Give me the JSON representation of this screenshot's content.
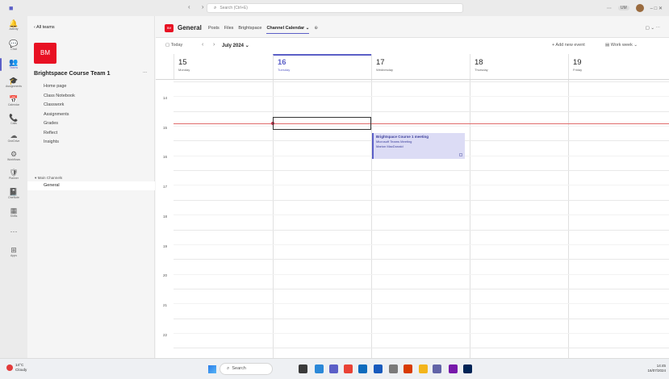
{
  "titlebar": {
    "search_placeholder": "Search (Ctrl+E)",
    "nav": "‹ ›",
    "controls": "⋯",
    "org_badge": "UM",
    "window_buttons": "– □ ✕"
  },
  "rail": [
    {
      "icon": "🔔",
      "label": "Activity"
    },
    {
      "icon": "💬",
      "label": "Chat"
    },
    {
      "icon": "👥",
      "label": "Teams"
    },
    {
      "icon": "🎓",
      "label": "Assignments"
    },
    {
      "icon": "📅",
      "label": "Calendar"
    },
    {
      "icon": "📞",
      "label": "Calls"
    },
    {
      "icon": "☁",
      "label": "OneDrive"
    },
    {
      "icon": "⚙",
      "label": "Workflows"
    },
    {
      "icon": "🛡",
      "label": "Planner"
    },
    {
      "icon": "📓",
      "label": "OneNote"
    },
    {
      "icon": "▦",
      "label": "Shifts"
    },
    {
      "icon": "⋯",
      "label": ""
    },
    {
      "icon": "⊞",
      "label": "Apps"
    }
  ],
  "team": {
    "back_label": "‹  All teams",
    "initials": "BM",
    "name": "Brightspace Course Team 1",
    "more": "...",
    "nav": [
      "Home page",
      "Class Notebook",
      "Classwork",
      "Assignments",
      "Grades",
      "Reflect",
      "Insights"
    ],
    "channels_header": "▾ Main Channels",
    "channel": "General"
  },
  "channel": {
    "tile": "BM",
    "title": "General",
    "tabs": [
      "Posts",
      "Files",
      "Brightspace",
      "Channel Calendar ⌄",
      "⊕"
    ],
    "active_tab_index": 3,
    "right_controls": "▢ ⌄  ⋯"
  },
  "toolbar": {
    "today": "▢ Today",
    "prev": "‹",
    "next": "›",
    "month": "July 2024 ⌄",
    "add_event": "+ Add new event",
    "view": "▤ Work week ⌄"
  },
  "days": [
    {
      "num": "15",
      "name": "Monday"
    },
    {
      "num": "16",
      "name": "Tuesday",
      "today": true
    },
    {
      "num": "17",
      "name": "Wednesday"
    },
    {
      "num": "18",
      "name": "Thursday"
    },
    {
      "num": "19",
      "name": "Friday"
    }
  ],
  "hours": [
    "14",
    "15",
    "16",
    "17",
    "18",
    "19",
    "20",
    "21",
    "22",
    "23"
  ],
  "event": {
    "title": "Brightspace Course 1 meeting",
    "subtitle": "Microsoft Teams Meeting",
    "organizer": "Marion MacDonald"
  },
  "taskbar": {
    "temp": "14°C",
    "weather": "Cloudy",
    "search": "Search",
    "time": "14:45",
    "date": "16/07/2024"
  },
  "colors": {
    "accent": "#5b5fc7",
    "team_tile": "#e81123",
    "event_bg": "#dcdcf5",
    "now_line": "#e06c6c"
  }
}
